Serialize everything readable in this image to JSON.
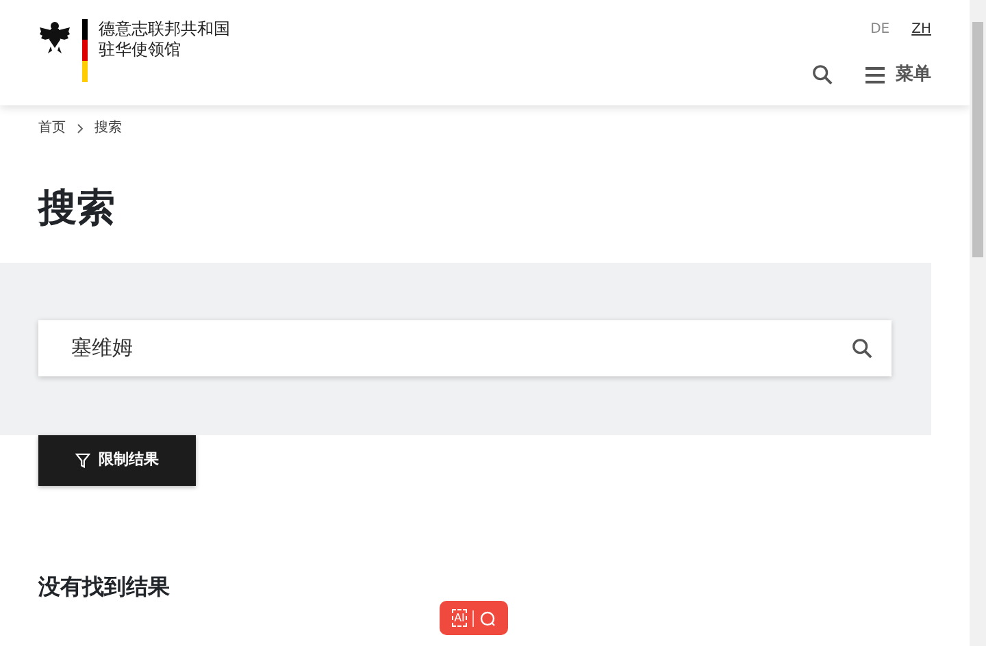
{
  "header": {
    "logo_lines": [
      "德意志联邦共和国",
      "驻华使领馆"
    ],
    "languages": [
      {
        "label": "DE",
        "selected": false
      },
      {
        "label": "ZH",
        "selected": true
      }
    ],
    "menu_label": "菜单"
  },
  "breadcrumb": [
    "首页",
    "搜索"
  ],
  "title": "搜索",
  "search": {
    "value": "塞维姆"
  },
  "filter_button": "限制结果",
  "result_heading": "没有找到结果",
  "assistant": {
    "label": "AI"
  }
}
